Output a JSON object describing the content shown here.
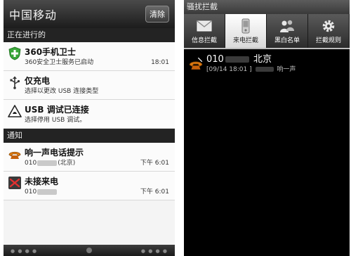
{
  "left": {
    "carrier": "中国移动",
    "clear_button": "清除",
    "ongoing_header": "正在进行的",
    "ongoing": [
      {
        "title": "360手机卫士",
        "subtitle": "360安全卫士服务已启动",
        "time": "18:01",
        "icon": "shield-icon"
      },
      {
        "title": "仅充电",
        "subtitle": "选择以更改 USB 连接类型",
        "time": "",
        "icon": "usb-icon"
      },
      {
        "title": "USB 调试已连接",
        "subtitle": "选择停用 USB 调试。",
        "time": "",
        "icon": "warning-icon"
      }
    ],
    "notify_header": "通知",
    "notifications": [
      {
        "title": "响一声电话提示",
        "number_prefix": "010",
        "location": "(北京)",
        "time": "下午 6:01",
        "icon": "ring-once-phone-icon"
      },
      {
        "title": "未接来电",
        "number_prefix": "010",
        "location": "",
        "time": "下午 6:01",
        "icon": "missed-call-icon"
      }
    ]
  },
  "right": {
    "title": "骚扰拦截",
    "tabs": [
      {
        "label": "信息拦截",
        "icon": "envelope-icon",
        "active": false
      },
      {
        "label": "来电拦截",
        "icon": "phone-icon",
        "active": true
      },
      {
        "label": "黑白名单",
        "icon": "people-icon",
        "active": false
      },
      {
        "label": "拦截规则",
        "icon": "gear-icon",
        "active": false
      }
    ],
    "calls": [
      {
        "number_prefix": "010",
        "location": "北京",
        "datetime": "[09/14 18:01 ]",
        "type": "响一声"
      }
    ]
  },
  "colors": {
    "shade_bg": "#f4f4f4",
    "header_bg": "#232323",
    "app_bg": "#000000",
    "accent_orange": "#e07a10",
    "shield_green": "#3aa63a"
  }
}
